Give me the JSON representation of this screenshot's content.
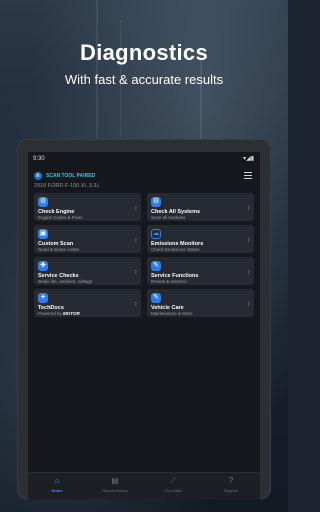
{
  "promo": {
    "headline": "Diagnostics",
    "subline": "With fast & accurate results"
  },
  "status_bar": {
    "time": "9:30",
    "icons": "▾◢▮"
  },
  "scan_tool": {
    "status": "SCAN TOOL PAIRED",
    "icon": "bluetooth-icon"
  },
  "vehicle": "2018 FORD F-150 XL 3.3L",
  "cards": [
    {
      "title": "Check Engine",
      "sub": "Engine Codes & Fixes",
      "icon": "engine-icon",
      "glyph": "⚙"
    },
    {
      "title": "Check All Systems",
      "sub": "Scan all modules",
      "icon": "scan-icon",
      "glyph": "⚙"
    },
    {
      "title": "Custom Scan",
      "sub": "Read & Erase codes",
      "icon": "car-icon",
      "glyph": "🚘"
    },
    {
      "title": "Emissions Monitors",
      "sub": "Check Emissions Status",
      "icon": "cloud-icon",
      "glyph": "☁"
    },
    {
      "title": "Service Checks",
      "sub": "Brake life, ambient, voltage",
      "icon": "service-icon",
      "glyph": "✚"
    },
    {
      "title": "Service Functions",
      "sub": "Resets & relearns",
      "icon": "wrench-icon",
      "glyph": "✎"
    },
    {
      "title": "TechDocs",
      "sub": "Powered by",
      "brand": "MOTOR",
      "icon": "docs-icon",
      "glyph": "✦"
    },
    {
      "title": "Vehicle Care",
      "sub": "Maintenance & More",
      "icon": "care-icon",
      "glyph": "✎"
    }
  ],
  "nav": [
    {
      "label": "Home",
      "icon": "home-icon",
      "glyph": "⌂",
      "active": true
    },
    {
      "label": "Report History",
      "icon": "report-icon",
      "glyph": "▤",
      "active": false
    },
    {
      "label": "Live Data",
      "icon": "chart-icon",
      "glyph": "⟋",
      "active": false
    },
    {
      "label": "Support",
      "icon": "support-icon",
      "glyph": "?",
      "active": false
    }
  ],
  "colors": {
    "accent": "#2d7ff0",
    "teal": "#3cc6d6",
    "card": "#262a31",
    "screen": "#15181d"
  }
}
